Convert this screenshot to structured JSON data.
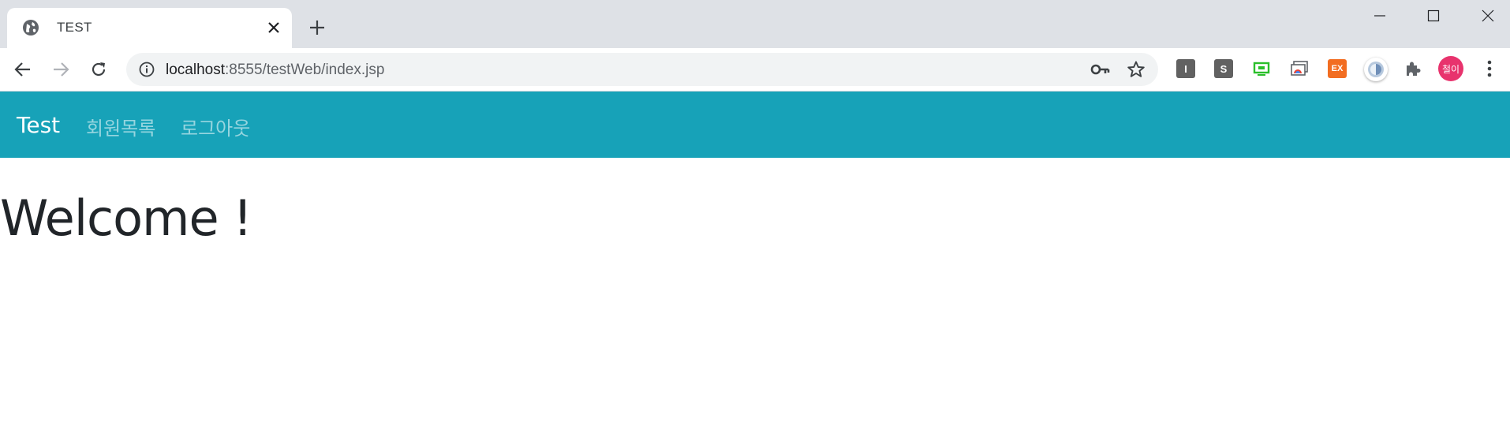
{
  "browser": {
    "tab": {
      "title": "TEST"
    },
    "address_bar": {
      "host": "localhost",
      "path": ":8555/testWeb/index.jsp"
    },
    "extensions": [
      {
        "name": "I",
        "color": "#616161"
      },
      {
        "name": "S",
        "color": "#616161"
      },
      {
        "name": "screen-extension-icon",
        "color": "#2bbf2b"
      },
      {
        "name": "window-extension-icon",
        "color": "#5f6368"
      },
      {
        "name": "EX",
        "color": "#f26d21"
      }
    ],
    "profile": {
      "label": "철이",
      "color": "#e8336d"
    }
  },
  "page": {
    "navbar": {
      "brand": "Test",
      "links": [
        "회원목록",
        "로그아웃"
      ],
      "color": "#17a2b8"
    },
    "heading": "Welcome !"
  }
}
